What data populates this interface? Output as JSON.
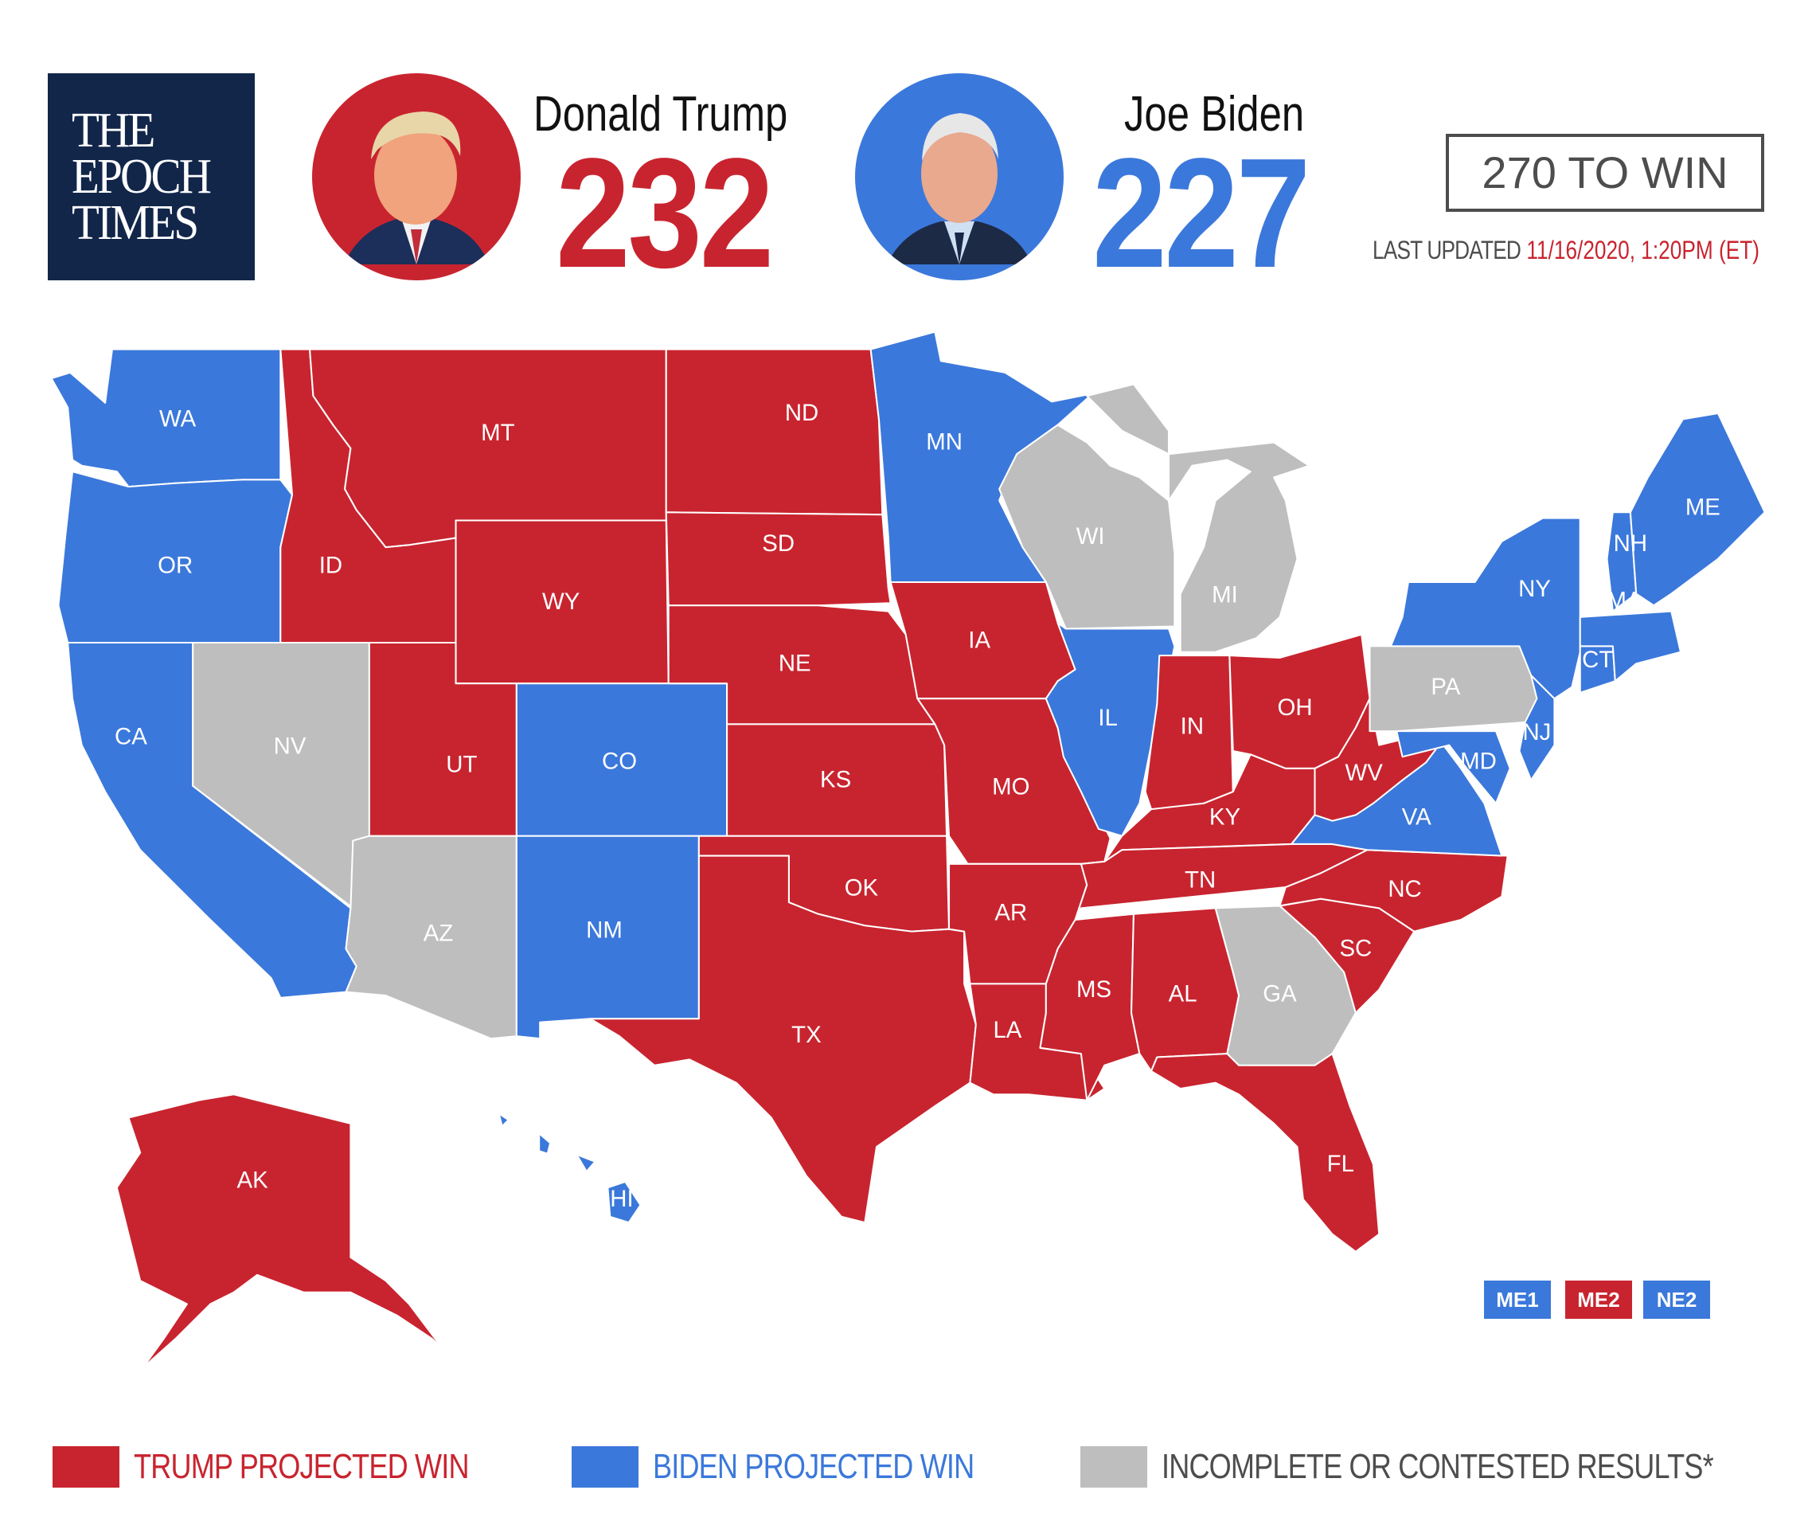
{
  "brand": {
    "lines": [
      "THE",
      "EPOCH",
      "TIMES"
    ],
    "bg_color": "#12264a"
  },
  "colors": {
    "trump": "#c8242f",
    "biden": "#3b78db",
    "contested": "#bebebe",
    "text_gray": "#4d4d4d"
  },
  "candidates": [
    {
      "name": "Donald Trump",
      "electoral_votes": "232",
      "party_color": "#c8242f",
      "portrait": "trump-portrait"
    },
    {
      "name": "Joe Biden",
      "electoral_votes": "227",
      "party_color": "#3b78db",
      "portrait": "biden-portrait"
    }
  ],
  "threshold": "270 TO WIN",
  "last_updated": {
    "label": "LAST UPDATED",
    "value": "11/16/2020, 1:20PM (ET)"
  },
  "states": [
    {
      "abbr": "WA",
      "winner": "biden"
    },
    {
      "abbr": "OR",
      "winner": "biden"
    },
    {
      "abbr": "CA",
      "winner": "biden"
    },
    {
      "abbr": "NV",
      "winner": "contested"
    },
    {
      "abbr": "ID",
      "winner": "trump"
    },
    {
      "abbr": "MT",
      "winner": "trump"
    },
    {
      "abbr": "WY",
      "winner": "trump"
    },
    {
      "abbr": "UT",
      "winner": "trump"
    },
    {
      "abbr": "AZ",
      "winner": "contested"
    },
    {
      "abbr": "CO",
      "winner": "biden"
    },
    {
      "abbr": "NM",
      "winner": "biden"
    },
    {
      "abbr": "ND",
      "winner": "trump"
    },
    {
      "abbr": "SD",
      "winner": "trump"
    },
    {
      "abbr": "NE",
      "winner": "trump"
    },
    {
      "abbr": "KS",
      "winner": "trump"
    },
    {
      "abbr": "OK",
      "winner": "trump"
    },
    {
      "abbr": "TX",
      "winner": "trump"
    },
    {
      "abbr": "MN",
      "winner": "biden"
    },
    {
      "abbr": "IA",
      "winner": "trump"
    },
    {
      "abbr": "MO",
      "winner": "trump"
    },
    {
      "abbr": "AR",
      "winner": "trump"
    },
    {
      "abbr": "LA",
      "winner": "trump"
    },
    {
      "abbr": "WI",
      "winner": "contested"
    },
    {
      "abbr": "IL",
      "winner": "biden"
    },
    {
      "abbr": "MI",
      "winner": "contested"
    },
    {
      "abbr": "IN",
      "winner": "trump"
    },
    {
      "abbr": "OH",
      "winner": "trump"
    },
    {
      "abbr": "KY",
      "winner": "trump"
    },
    {
      "abbr": "TN",
      "winner": "trump"
    },
    {
      "abbr": "MS",
      "winner": "trump"
    },
    {
      "abbr": "AL",
      "winner": "trump"
    },
    {
      "abbr": "GA",
      "winner": "contested"
    },
    {
      "abbr": "FL",
      "winner": "trump"
    },
    {
      "abbr": "SC",
      "winner": "trump"
    },
    {
      "abbr": "NC",
      "winner": "trump"
    },
    {
      "abbr": "VA",
      "winner": "biden"
    },
    {
      "abbr": "WV",
      "winner": "trump"
    },
    {
      "abbr": "PA",
      "winner": "contested"
    },
    {
      "abbr": "MD",
      "winner": "biden"
    },
    {
      "abbr": "NJ",
      "winner": "biden"
    },
    {
      "abbr": "NY",
      "winner": "biden"
    },
    {
      "abbr": "CT",
      "winner": "biden"
    },
    {
      "abbr": "MA",
      "winner": "biden"
    },
    {
      "abbr": "NH",
      "winner": "biden"
    },
    {
      "abbr": "ME",
      "winner": "biden"
    },
    {
      "abbr": "AK",
      "winner": "trump"
    },
    {
      "abbr": "HI",
      "winner": "biden"
    }
  ],
  "districts": [
    {
      "label": "ME1",
      "winner": "biden"
    },
    {
      "label": "ME2",
      "winner": "trump"
    },
    {
      "label": "NE2",
      "winner": "biden"
    }
  ],
  "legend": [
    {
      "label": "TRUMP PROJECTED WIN",
      "color": "#c8242f",
      "text_color": "#c8242f"
    },
    {
      "label": "BIDEN PROJECTED WIN",
      "color": "#3b78db",
      "text_color": "#3b78db"
    },
    {
      "label": "INCOMPLETE OR CONTESTED RESULTS*",
      "color": "#bebebe",
      "text_color": "#4d4d4d"
    }
  ]
}
